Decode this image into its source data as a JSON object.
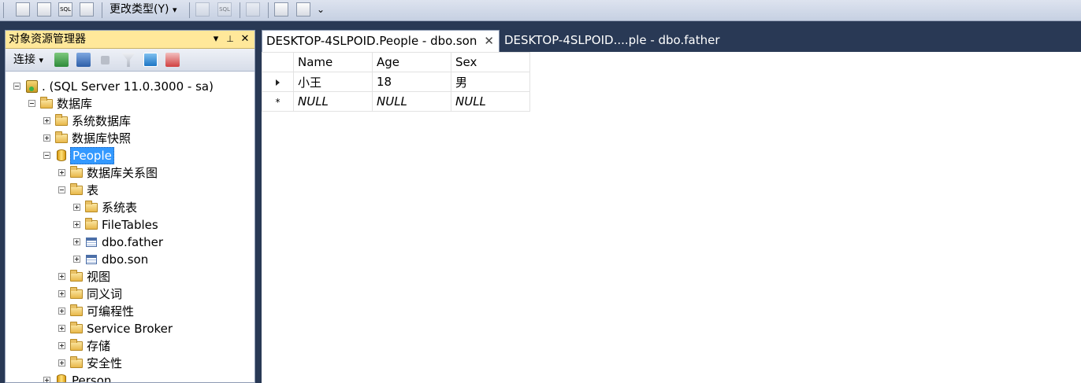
{
  "toolbar": {
    "change_type_label": "更改类型(Y)",
    "dropdown_glyph": "▾",
    "overflow_glyph": "⌄"
  },
  "explorer": {
    "title": "对象资源管理器",
    "pin_glyph": "▾",
    "dock_glyph": "ᵖ",
    "close_glyph": "✕",
    "connect_label": "连接",
    "connect_glyph": "▾"
  },
  "tree": {
    "server": ". (SQL Server 11.0.3000 - sa)",
    "databases": "数据库",
    "system_databases": "系统数据库",
    "db_snapshots": "数据库快照",
    "people": "People",
    "db_diagrams": "数据库关系图",
    "tables": "表",
    "system_tables": "系统表",
    "file_tables": "FileTables",
    "dbo_father": "dbo.father",
    "dbo_son": "dbo.son",
    "views": "视图",
    "synonyms": "同义词",
    "programmability": "可编程性",
    "service_broker": "Service Broker",
    "storage": "存储",
    "security": "安全性",
    "person": "Person"
  },
  "tabs": {
    "active": "DESKTOP-4SLPOID.People - dbo.son",
    "active_close": "✕",
    "inactive": "DESKTOP-4SLPOID....ple - dbo.father"
  },
  "grid": {
    "columns": [
      "Name",
      "Age",
      "Sex"
    ],
    "rows": [
      {
        "marker": "current",
        "cells": [
          "小王",
          "18",
          "男"
        ]
      },
      {
        "marker": "*",
        "cells": [
          "NULL",
          "NULL",
          "NULL"
        ]
      }
    ]
  }
}
